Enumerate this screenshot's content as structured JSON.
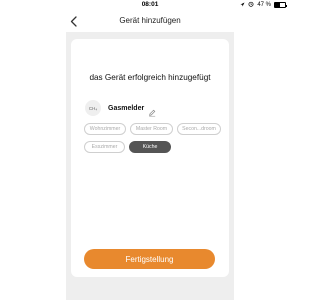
{
  "status_bar": {
    "time": "08:01",
    "battery_text": "47 %",
    "battery_level": 0.47
  },
  "header": {
    "title": "Gerät hinzufügen",
    "back_icon": "chevron-left-icon"
  },
  "main": {
    "success_message": "das Gerät erfolgreich hinzugefügt",
    "device": {
      "icon_label": "CH₄",
      "name": "Gasmelder",
      "edit_icon": "pencil-icon"
    },
    "rooms": [
      {
        "label": "Wohnzimmer",
        "selected": false
      },
      {
        "label": "Master Room",
        "selected": false
      },
      {
        "label": "Secon...droom",
        "selected": false
      },
      {
        "label": "Esszimmer",
        "selected": false
      },
      {
        "label": "Küche",
        "selected": true
      }
    ],
    "finish_label": "Fertigstellung"
  },
  "colors": {
    "accent": "#e8892e",
    "selected_chip": "#555555",
    "background": "#eeeeee"
  }
}
